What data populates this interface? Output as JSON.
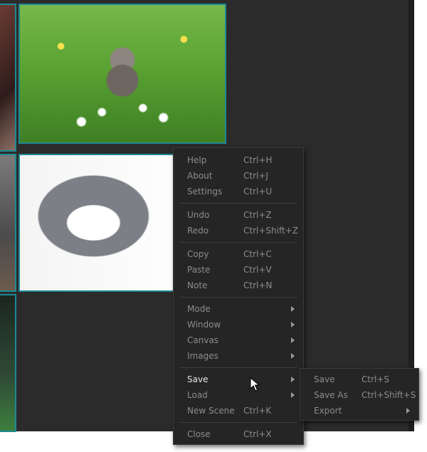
{
  "context_menu": {
    "groups": [
      [
        {
          "label": "Help",
          "shortcut": "Ctrl+H"
        },
        {
          "label": "About",
          "shortcut": "Ctrl+J"
        },
        {
          "label": "Settings",
          "shortcut": "Ctrl+U"
        }
      ],
      [
        {
          "label": "Undo",
          "shortcut": "Ctrl+Z"
        },
        {
          "label": "Redo",
          "shortcut": "Ctrl+Shift+Z"
        }
      ],
      [
        {
          "label": "Copy",
          "shortcut": "Ctrl+C"
        },
        {
          "label": "Paste",
          "shortcut": "Ctrl+V"
        },
        {
          "label": "Note",
          "shortcut": "Ctrl+N"
        }
      ],
      [
        {
          "label": "Mode",
          "submenu": true
        },
        {
          "label": "Window",
          "submenu": true
        },
        {
          "label": "Canvas",
          "submenu": true
        },
        {
          "label": "Images",
          "submenu": true
        }
      ],
      [
        {
          "label": "Save",
          "submenu": true,
          "active": true
        },
        {
          "label": "Load",
          "submenu": true
        },
        {
          "label": "New Scene",
          "shortcut": "Ctrl+K"
        }
      ],
      [
        {
          "label": "Close",
          "shortcut": "Ctrl+X"
        }
      ]
    ]
  },
  "save_submenu": {
    "items": [
      {
        "label": "Save",
        "shortcut": "Ctrl+S"
      },
      {
        "label": "Save As",
        "shortcut": "Ctrl+Shift+S"
      },
      {
        "label": "Export",
        "submenu": true
      }
    ]
  },
  "images": [
    {
      "name": "kitten-in-grass"
    },
    {
      "name": "gray-white-cat"
    }
  ],
  "colors": {
    "canvas_bg": "#2b2b2b",
    "menu_bg": "#252525",
    "thumb_border": "#1d8a94",
    "text_inactive": "#8c8c8c",
    "text_active": "#e6e6e6"
  }
}
